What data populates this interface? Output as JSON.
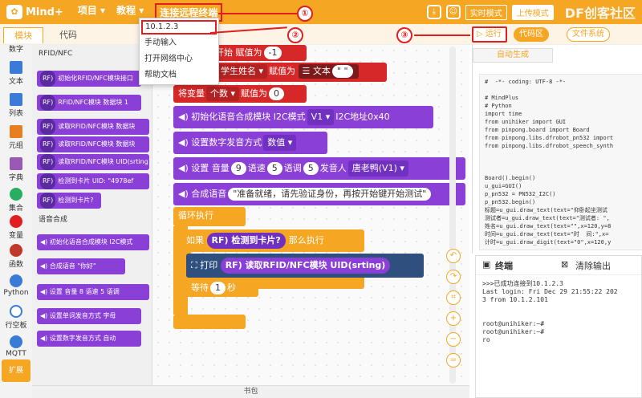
{
  "app": {
    "logo": "Mind+"
  },
  "menu": {
    "project": "项目 ▾",
    "tutorial": "教程 ▾",
    "remote": "连接远程终端"
  },
  "toolbar": {
    "mode_realtime": "实时模式",
    "mode_upload": "上传模式",
    "brand": "DF创客社区"
  },
  "tabs": {
    "modules": "模块",
    "code": "代码"
  },
  "actions": {
    "run": "运行",
    "code_area": "代码区",
    "file_system": "文件系统"
  },
  "dropdown": {
    "items": [
      "10.1.2.3",
      "手动输入",
      "打开网络中心",
      "帮助文档"
    ]
  },
  "annotations": [
    "①",
    "②",
    "③"
  ],
  "categories": [
    "数字",
    "文本",
    "列表",
    "元组",
    "字典",
    "集合",
    "变量",
    "函数",
    "Python",
    "行空板",
    "MQTT",
    "扩展"
  ],
  "palette": {
    "section_rfid": "RFID/NFC",
    "section_tts": "语音合成",
    "rfid_blocks": [
      "初始化RFID/NFC模块接口",
      "RFID/NFC模块 数据块 1",
      "读取RFID/NFC模块 数据块",
      "读取RFID/NFC模块 数据块",
      "读取RFID/NFC模块 UID(srting)",
      "检测到卡片 UID: \"4978ef",
      "检测到卡片?"
    ],
    "rf_tag": "RF)",
    "tts_blocks": [
      "初始化语音合成模块 I2C模式",
      "合成语音 \"你好\"",
      "设置 音量 8 语速 5 语调",
      "设置单词发音方式 字母",
      "设置数字发音方式 自动"
    ]
  },
  "workspace": {
    "set1": {
      "pre": "开始",
      "assign": "赋值为",
      "val": "-1"
    },
    "set2": {
      "var": "学生姓名 ▾",
      "assign": "赋值为",
      "text_kw": "文本",
      "val": "\" \""
    },
    "set3": {
      "kw": "将变量",
      "var": "个数 ▾",
      "assign": "赋值为",
      "val": "0"
    },
    "init_tts": {
      "text": "初始化语音合成模块 I2C模式",
      "mode": "V1 ▾",
      "addr": "I2C地址0x40"
    },
    "digit_mode": {
      "text": "设置数字发音方式",
      "val": "数值 ▾"
    },
    "set_voice": {
      "t1": "设置 音量",
      "v1": "9",
      "t2": "语速",
      "v2": "5",
      "t3": "语调",
      "v3": "5",
      "t4": "发音人",
      "v4": "唐老鸭(V1) ▾"
    },
    "speak": {
      "text": "合成语音",
      "val": "\"准备就绪，请先验证身份，再按开始键开始测试\""
    },
    "loop": "循环执行",
    "if": {
      "kw": "如果",
      "cond": "检测到卡片?",
      "then": "那么执行"
    },
    "print": {
      "kw": "打印",
      "val": "读取RFID/NFC模块 UID(srting)"
    },
    "wait": {
      "kw": "等待",
      "val": "1",
      "unit": "秒"
    },
    "rf": "RF)"
  },
  "code_panel": {
    "title": "自动生成",
    "code": "#  -*- coding: UTF-8 -*-\n\n# MindPlus\n# Python\nimport time\nfrom unihiker import GUI\nfrom pinpong.board import Board\nfrom pinpong.libs.dfrobot_pn532 import\nfrom pinpong.libs.dfrobot_speech_synth\n\n\n\nBoard().begin()\nu_gui=GUI()\np_pn532 = PN532_I2C()\np_pn532.begin()\n标题=u_gui.draw_text(text=\"仰卧起坐测试\n测试者=u_gui.draw_text(text=\"测试者: \",\n姓名=u_gui.draw_text(text=\"\",x=120,y=8\n时间=u_gui.draw_text(text=\"时  间:\",x=\n计时=u_gui.draw_digit(text=\"0\",x=120,y"
  },
  "terminal": {
    "title": "终端",
    "clear": "清除输出",
    "output": ">>>已成功连接到10.1.2.3\nLast login: Fri Dec 29 21:55:22 202\n3 from 10.1.2.101\n\n\nroot@unihiker:~#\nroot@unihiker:~#\nro"
  },
  "bottom": "书包",
  "colors": {
    "accent": "#f5a623",
    "red_block": "#d62828",
    "purple_block": "#8a3fd6",
    "highlight": "#e02020"
  }
}
